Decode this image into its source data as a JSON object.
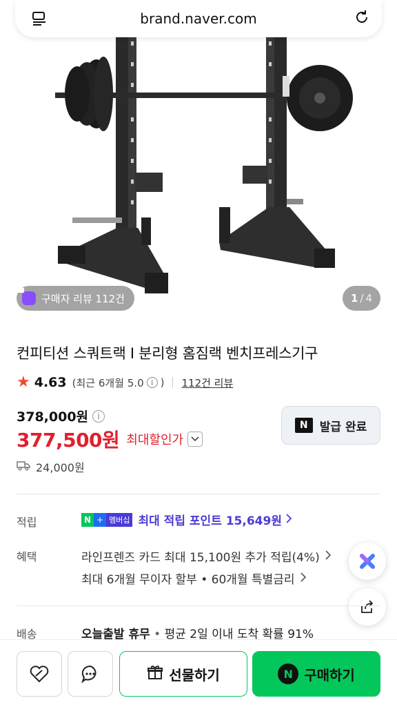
{
  "browser": {
    "url": "brand.naver.com"
  },
  "hero": {
    "review_badge": "구매자 리뷰 112건",
    "page_current": "1",
    "page_sep": "/",
    "page_total": "4"
  },
  "product": {
    "title": "컨피티션 스쿼트랙 I 분리형 홈짐랙 벤치프레스기구",
    "rating": "4.63",
    "rating_recent": "(최근 6개월 5.0",
    "rating_recent_close": ")",
    "review_link": "112건 리뷰",
    "original_price": "378,000원",
    "sale_price": "377,500원",
    "sale_label": "최대할인가",
    "coupon_button": "발급 완료",
    "shipping_fee": "24,000원"
  },
  "benefits": {
    "points_label": "적립",
    "points_badge_n": "N",
    "points_badge_plus": "+",
    "points_badge_member": "멤버십",
    "points_text": "최대 적립 포인트 15,649원",
    "benefit_label": "혜택",
    "benefit_line1": "라인프렌즈 카드 최대 15,100원 추가 적립(4%)",
    "benefit_line2": "최대 6개월 무이자 할부 • 60개월 특별금리",
    "delivery_label": "배송",
    "delivery_bold": "오늘출발 휴무",
    "delivery_dot": " • ",
    "delivery_rest": "평균 2일 이내 도착 확률 91%"
  },
  "bottom_bar": {
    "gift_button": "선물하기",
    "buy_button": "구매하기",
    "buy_logo": "N"
  },
  "colors": {
    "naver_green": "#03c75a",
    "sale_red": "#e0202e",
    "member_purple": "#4a3bd6"
  }
}
